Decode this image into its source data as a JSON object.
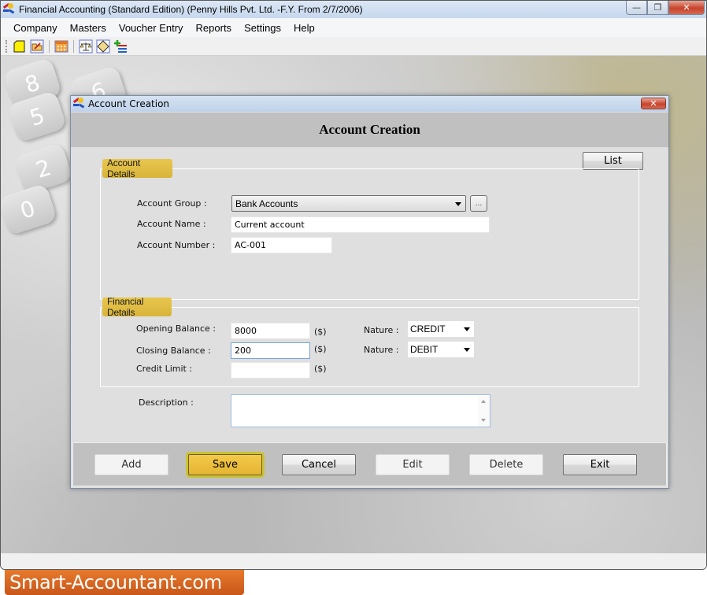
{
  "window": {
    "title": "Financial Accounting (Standard Edition) (Penny Hills Pvt. Ltd. -F.Y. From 2/7/2006)",
    "controls": {
      "minimize": "—",
      "restore": "❐",
      "close": "✕"
    }
  },
  "menubar": {
    "items": [
      "Company",
      "Masters",
      "Voucher Entry",
      "Reports",
      "Settings",
      "Help"
    ]
  },
  "toolbar": {
    "icons": [
      "new-document-icon",
      "open-folder-icon",
      "calendar-grid-icon",
      "balance-scale-icon",
      "ledger-book-icon",
      "add-list-icon"
    ]
  },
  "background": {
    "calc_keys": [
      "8",
      "5",
      "2",
      "0",
      "6"
    ]
  },
  "dialog": {
    "title": "Account Creation",
    "close": "✕",
    "heading": "Account Creation",
    "list_button": "List",
    "account_details": {
      "legend": "Account Details",
      "account_group_label": "Account Group :",
      "account_group_value": "Bank Accounts",
      "browse_button": "...",
      "account_name_label": "Account Name :",
      "account_name_value": "Current account",
      "account_number_label": "Account Number :",
      "account_number_value": "AC-001"
    },
    "financial_details": {
      "legend": "Financial Details",
      "opening_balance_label": "Opening Balance :",
      "opening_balance_value": "8000",
      "closing_balance_label": "Closing Balance :",
      "closing_balance_value": "200",
      "credit_limit_label": "Credit Limit :",
      "credit_limit_value": "",
      "currency_unit": "($)",
      "nature_label": "Nature :",
      "opening_nature": "CREDIT",
      "closing_nature": "DEBIT"
    },
    "description_label": "Description :",
    "description_value": "",
    "buttons": {
      "add": "Add",
      "save": "Save",
      "cancel": "Cancel",
      "edit": "Edit",
      "delete": "Delete",
      "exit": "Exit"
    }
  },
  "brand": {
    "text": "Smart-Accountant.com",
    "color": "#d9661f"
  }
}
